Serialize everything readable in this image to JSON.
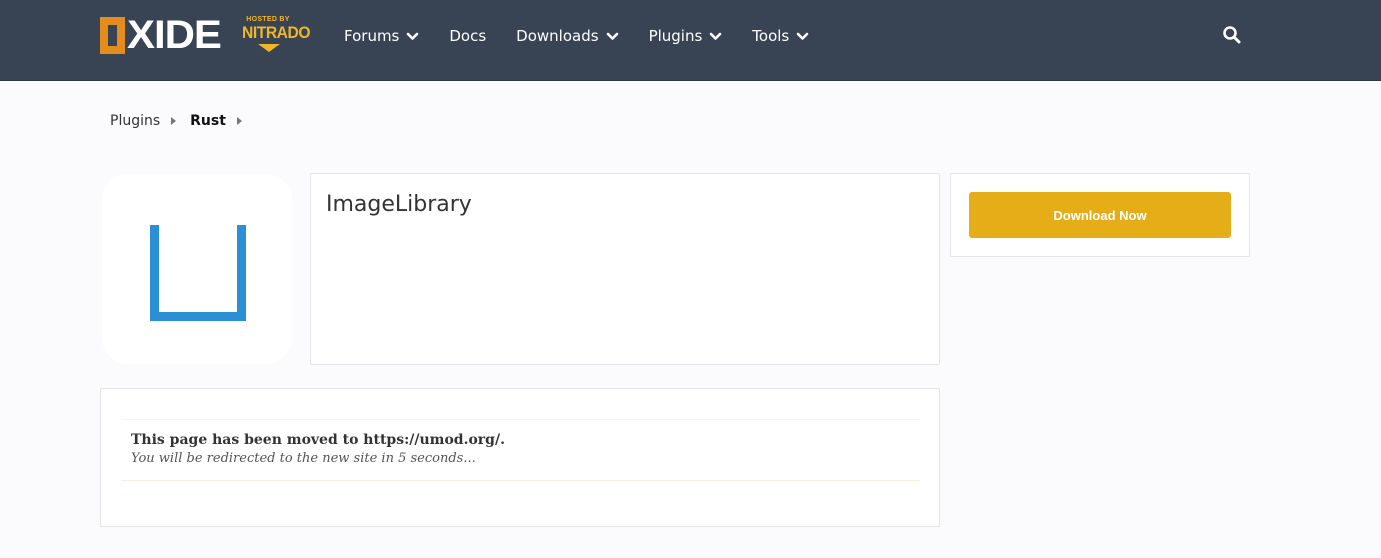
{
  "header": {
    "logo_text": "XIDE",
    "hosted_by": "HOSTED BY",
    "hosted_brand": "NITRADO",
    "nav": [
      {
        "label": "Forums",
        "has_dropdown": true
      },
      {
        "label": "Docs",
        "has_dropdown": false
      },
      {
        "label": "Downloads",
        "has_dropdown": true
      },
      {
        "label": "Plugins",
        "has_dropdown": true
      },
      {
        "label": "Tools",
        "has_dropdown": true
      }
    ],
    "search_icon": "search-icon"
  },
  "breadcrumb": {
    "items": [
      "Plugins",
      "Rust"
    ]
  },
  "plugin": {
    "title": "ImageLibrary",
    "icon": "bracket-logo-icon",
    "icon_color": "#2b8fd6"
  },
  "download": {
    "label": "Download Now",
    "color": "#e5ae18"
  },
  "notice": {
    "main": "This page has been moved to https://umod.org/.",
    "sub": "You will be redirected to the new site in 5 seconds..."
  },
  "colors": {
    "header_bg": "#384454",
    "accent_orange": "#e58d1c",
    "accent_yellow": "#f0b62a"
  }
}
